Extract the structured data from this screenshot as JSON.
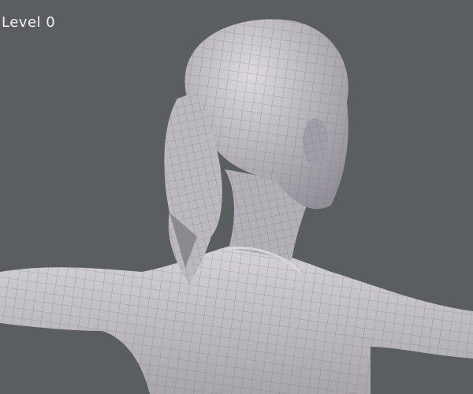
{
  "viewport": {
    "level_label": "Level 0",
    "background_color": "#5b5e61",
    "mesh_color": "#c9c6cc",
    "wire_color": "#6e6a72"
  }
}
